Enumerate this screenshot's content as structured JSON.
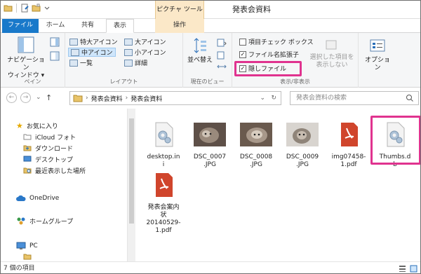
{
  "window": {
    "title": "発表会資料",
    "contextual_tab_group": "ピクチャ ツール"
  },
  "tabs": [
    {
      "label": "ファイル"
    },
    {
      "label": "ホーム"
    },
    {
      "label": "共有"
    },
    {
      "label": "表示",
      "active": true
    },
    {
      "label": "操作"
    }
  ],
  "ribbon": {
    "pane": {
      "navigation_pane_line1": "ナビゲーション",
      "navigation_pane_line2": "ウィンドウ ▾",
      "group_label": "ペイン"
    },
    "layout": {
      "items": [
        "特大アイコン",
        "大アイコン",
        "中アイコン",
        "小アイコン",
        "一覧",
        "詳細"
      ],
      "selected": "中アイコン",
      "group_label": "レイアウト"
    },
    "current_view": {
      "sort_label": "並べ替え",
      "group_label": "現在のビュー"
    },
    "show_hide": {
      "item_checkboxes": {
        "label": "項目チェック ボックス",
        "checked": false
      },
      "file_extensions": {
        "label": "ファイル名拡張子",
        "checked": true
      },
      "hidden_items": {
        "label": "隠しファイル",
        "checked": true
      },
      "hide_selected_line1": "選択した項目を",
      "hide_selected_line2": "表示しない",
      "group_label": "表示/非表示"
    },
    "options_label": "オプション"
  },
  "address": {
    "path": [
      "発表会資料",
      "発表会資料"
    ],
    "search_placeholder": "発表会資料の検索"
  },
  "nav_pane": {
    "items": [
      {
        "label": "お気に入り",
        "icon": "star-icon"
      },
      {
        "label": "iCloud フォト",
        "icon": "folder-icon"
      },
      {
        "label": "ダウンロード",
        "icon": "download-folder-icon"
      },
      {
        "label": "デスクトップ",
        "icon": "desktop-icon"
      },
      {
        "label": "最近表示した場所",
        "icon": "recent-places-icon"
      },
      {
        "label": "OneDrive",
        "icon": "cloud-icon"
      },
      {
        "label": "ホームグループ",
        "icon": "homegroup-icon"
      },
      {
        "label": "PC",
        "icon": "computer-icon"
      }
    ]
  },
  "files": [
    {
      "name": "desktop.ini",
      "line1": "desktop.in",
      "line2": "i",
      "type": "settings"
    },
    {
      "name": "DSC_0007.JPG",
      "line1": "DSC_0007",
      "line2": ".JPG",
      "type": "photo"
    },
    {
      "name": "DSC_0008.JPG",
      "line1": "DSC_0008",
      "line2": ".JPG",
      "type": "photo"
    },
    {
      "name": "DSC_0009.JPG",
      "line1": "DSC_0009",
      "line2": ".JPG",
      "type": "photo"
    },
    {
      "name": "img07458-1.pdf",
      "line1": "img07458-",
      "line2": "1.pdf",
      "type": "pdf"
    },
    {
      "name": "Thumbs.db",
      "line1": "Thumbs.d",
      "line2": "b",
      "type": "settings"
    },
    {
      "name": "発表会案内状20140529-1.pdf",
      "line1": "発表会案内",
      "line2": "状",
      "line3": "20140529-",
      "line4": "1.pdf",
      "type": "pdf"
    }
  ],
  "status": {
    "item_count": "7 個の項目"
  },
  "colors": {
    "file_tab": "#1979ca",
    "highlight": "#e0338f",
    "contextual_tab": "#fbe8c8",
    "pdf_red": "#d0452c"
  }
}
